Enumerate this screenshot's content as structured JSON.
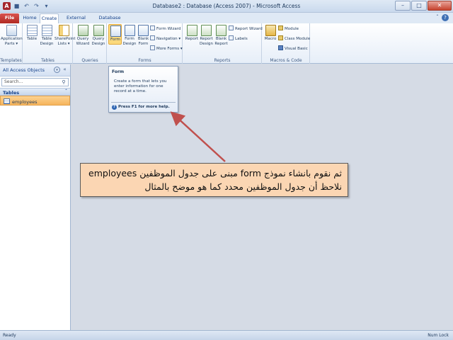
{
  "window": {
    "title": "Database2 : Database (Access 2007) - Microsoft Access"
  },
  "tabs": [
    "File",
    "Home",
    "Create",
    "External Data",
    "Database Tools"
  ],
  "active_tab": "Create",
  "ribbon": {
    "templates": {
      "label": "Templates",
      "application_parts": "Application Parts ▾"
    },
    "tables": {
      "label": "Tables",
      "table": "Table",
      "table_design": "Table Design",
      "sharepoint_lists": "SharePoint Lists ▾"
    },
    "queries": {
      "label": "Queries",
      "query_wizard": "Query Wizard",
      "query_design": "Query Design"
    },
    "forms": {
      "label": "Forms",
      "form": "Form",
      "form_design": "Form Design",
      "blank_form": "Blank Form",
      "form_wizard": "Form Wizard",
      "navigation": "Navigation ▾",
      "more_forms": "More Forms ▾"
    },
    "reports": {
      "label": "Reports",
      "report": "Report",
      "report_design": "Report Design",
      "blank_report": "Blank Report",
      "report_wizard": "Report Wizard",
      "labels": "Labels"
    },
    "macros": {
      "label": "Macros & Code",
      "macro": "Macro",
      "module": "Module",
      "class_module": "Class Module",
      "visual_basic": "Visual Basic"
    }
  },
  "navpane": {
    "title": "All Access Objects",
    "search_placeholder": "Search...",
    "section": "Tables",
    "items": [
      {
        "label": "employees"
      }
    ]
  },
  "tooltip": {
    "title": "Form",
    "description": "Create a form that lets you enter information for one record at a time.",
    "help": "Press F1 for more help."
  },
  "annotation": {
    "line1": "ثم نقوم بانشاء نموذج form مبنى على جدول الموظفين employees",
    "line2": "نلاحظ أن جدول الموظفين محدد كما هو موضح بالمثال"
  },
  "statusbar": {
    "left": "Ready",
    "right": "Num Lock"
  },
  "colors": {
    "accent": "#15428b",
    "file_tab": "#b02a22",
    "selected": "#f6b45b",
    "callout_bg": "#fbd6b3",
    "arrow": "#c0504d"
  }
}
